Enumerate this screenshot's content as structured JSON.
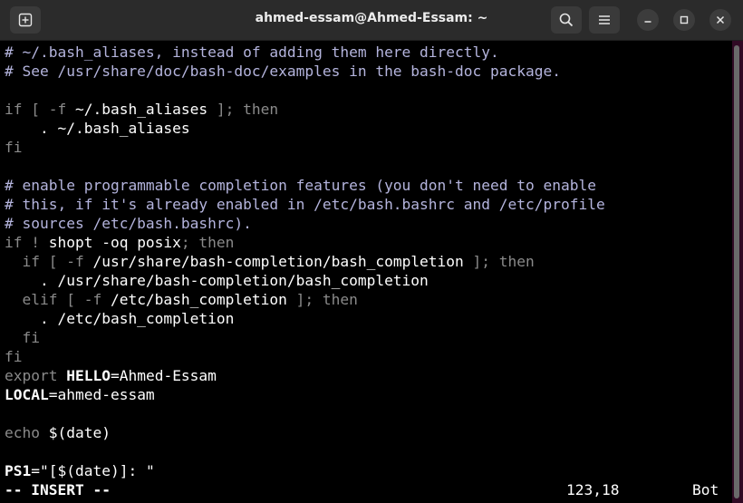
{
  "window": {
    "title": "ahmed-essam@Ahmed-Essam: ~",
    "new_tab_icon": "new-tab-icon",
    "search_icon": "search-icon",
    "menu_icon": "hamburger-menu-icon",
    "minimize_icon": "minimize-icon",
    "maximize_icon": "maximize-icon",
    "close_icon": "close-icon"
  },
  "editor": {
    "lines": [
      {
        "segments": [
          {
            "t": "# ~/.bash_aliases, instead of adding them here directly.",
            "cls": "c"
          }
        ]
      },
      {
        "segments": [
          {
            "t": "# See /usr/share/doc/bash-doc/examples in the bash-doc package.",
            "cls": "c"
          }
        ]
      },
      {
        "segments": []
      },
      {
        "segments": [
          {
            "t": "if [ -f ",
            "cls": "k"
          },
          {
            "t": "~/.bash_aliases",
            "cls": "s"
          },
          {
            "t": " ]; then",
            "cls": "k"
          }
        ]
      },
      {
        "segments": [
          {
            "t": "    . ~/.bash_aliases",
            "cls": "s"
          }
        ]
      },
      {
        "segments": [
          {
            "t": "fi",
            "cls": "k"
          }
        ]
      },
      {
        "segments": []
      },
      {
        "segments": [
          {
            "t": "# enable programmable completion features (you don't need to enable",
            "cls": "c"
          }
        ]
      },
      {
        "segments": [
          {
            "t": "# this, if it's already enabled in /etc/bash.bashrc and /etc/profile",
            "cls": "c"
          }
        ]
      },
      {
        "segments": [
          {
            "t": "# sources /etc/bash.bashrc).",
            "cls": "c"
          }
        ]
      },
      {
        "segments": [
          {
            "t": "if ! ",
            "cls": "k"
          },
          {
            "t": "shopt -oq posix",
            "cls": "s"
          },
          {
            "t": "; then",
            "cls": "k"
          }
        ]
      },
      {
        "segments": [
          {
            "t": "  if [ -f ",
            "cls": "k"
          },
          {
            "t": "/usr/share/bash-completion/bash_completion",
            "cls": "s"
          },
          {
            "t": " ]; then",
            "cls": "k"
          }
        ]
      },
      {
        "segments": [
          {
            "t": "    . /usr/share/bash-completion/bash_completion",
            "cls": "s"
          }
        ]
      },
      {
        "segments": [
          {
            "t": "  elif [ -f ",
            "cls": "k"
          },
          {
            "t": "/etc/bash_completion",
            "cls": "s"
          },
          {
            "t": " ]; then",
            "cls": "k"
          }
        ]
      },
      {
        "segments": [
          {
            "t": "    . /etc/bash_completion",
            "cls": "s"
          }
        ]
      },
      {
        "segments": [
          {
            "t": "  fi",
            "cls": "k"
          }
        ]
      },
      {
        "segments": [
          {
            "t": "fi",
            "cls": "k"
          }
        ]
      },
      {
        "segments": [
          {
            "t": "export ",
            "cls": "k"
          },
          {
            "t": "HELLO",
            "cls": "b"
          },
          {
            "t": "=Ahmed-Essam",
            "cls": "s"
          }
        ]
      },
      {
        "segments": [
          {
            "t": "LOCAL",
            "cls": "b"
          },
          {
            "t": "=ahmed-essam",
            "cls": "s"
          }
        ]
      },
      {
        "segments": []
      },
      {
        "segments": [
          {
            "t": "echo ",
            "cls": "k"
          },
          {
            "t": "$(date)",
            "cls": "s"
          }
        ]
      },
      {
        "segments": []
      },
      {
        "segments": [
          {
            "t": "PS1",
            "cls": "b"
          },
          {
            "t": "=\"[$(date)]: \"",
            "cls": "s"
          }
        ]
      }
    ]
  },
  "statusbar": {
    "mode": "-- INSERT --",
    "position": "123,18",
    "scroll": "Bot"
  }
}
